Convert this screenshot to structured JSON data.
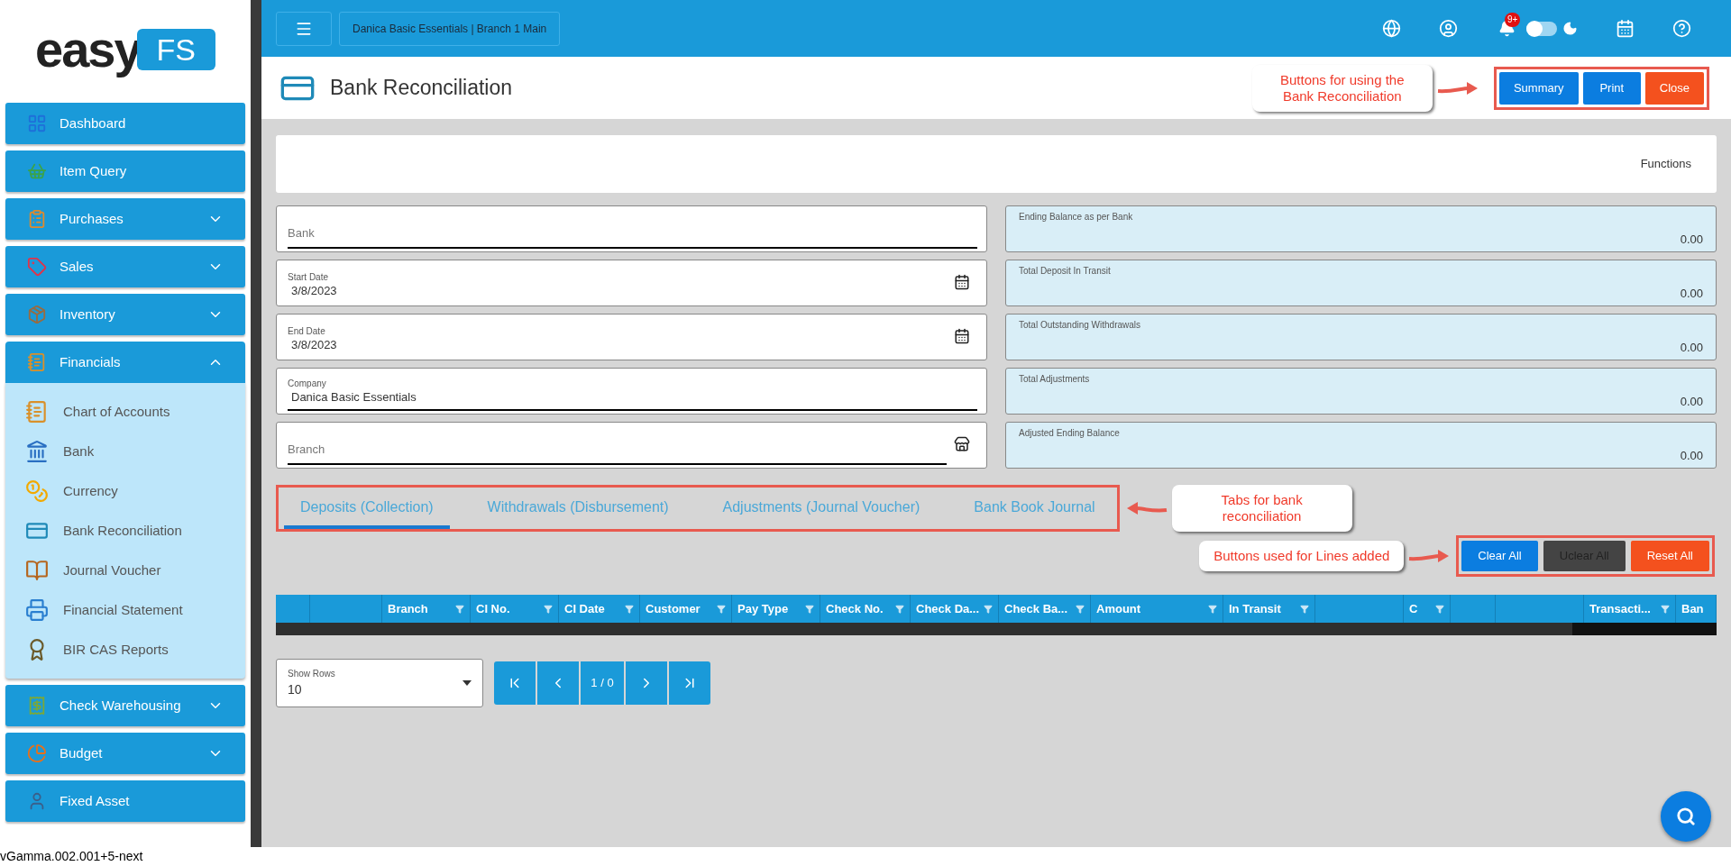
{
  "sidebar": {
    "logo": {
      "word": "easy",
      "badge": "FS"
    },
    "items": [
      {
        "label": "Dashboard"
      },
      {
        "label": "Item Query"
      },
      {
        "label": "Purchases",
        "expanded": false
      },
      {
        "label": "Sales",
        "expanded": false
      },
      {
        "label": "Inventory",
        "expanded": false
      },
      {
        "label": "Financials",
        "expanded": true,
        "children": [
          {
            "label": "Chart of Accounts"
          },
          {
            "label": "Bank"
          },
          {
            "label": "Currency"
          },
          {
            "label": "Bank Reconciliation"
          },
          {
            "label": "Journal Voucher"
          },
          {
            "label": "Financial Statement"
          },
          {
            "label": "BIR CAS Reports"
          }
        ]
      },
      {
        "label": "Check Warehousing",
        "expanded": false
      },
      {
        "label": "Budget",
        "expanded": false
      },
      {
        "label": "Fixed Asset"
      }
    ]
  },
  "topbar": {
    "context": "Danica Basic Essentials | Branch 1 Main",
    "notifications": "9+",
    "dark_mode": false
  },
  "header": {
    "title": "Bank Reconciliation",
    "buttons": [
      {
        "label": "Summary",
        "kind": "primary"
      },
      {
        "label": "Print",
        "kind": "primary"
      },
      {
        "label": "Close",
        "kind": "danger"
      }
    ],
    "callout": "Buttons for using the Bank Reconciliation"
  },
  "functions": {
    "label": "Functions"
  },
  "fields": [
    {
      "kind": "text",
      "placeholder": "Bank"
    },
    {
      "kind": "date",
      "label": "Start Date",
      "value": "3/8/2023"
    },
    {
      "kind": "date",
      "label": "End Date",
      "value": "3/8/2023"
    },
    {
      "kind": "text",
      "label": "Company",
      "value": "Danica Basic Essentials"
    },
    {
      "kind": "lookup",
      "placeholder": "Branch"
    }
  ],
  "totals": [
    {
      "label": "Ending Balance as per Bank",
      "value": "0.00"
    },
    {
      "label": "Total Deposit In Transit",
      "value": "0.00"
    },
    {
      "label": "Total Outstanding Withdrawals",
      "value": "0.00"
    },
    {
      "label": "Total Adjustments",
      "value": "0.00"
    },
    {
      "label": "Adjusted Ending Balance",
      "value": "0.00"
    }
  ],
  "tabs": [
    {
      "label": "Deposits (Collection)",
      "selected": true
    },
    {
      "label": "Withdrawals (Disbursement)",
      "selected": false
    },
    {
      "label": "Adjustments (Journal Voucher)",
      "selected": false
    },
    {
      "label": "Bank Book Journal",
      "selected": false
    }
  ],
  "tabs_callout": "Tabs for bank reconciliation",
  "line_buttons": [
    {
      "label": "Clear All",
      "kind": "primary"
    },
    {
      "label": "Uclear All",
      "kind": "dark"
    },
    {
      "label": "Reset All",
      "kind": "danger"
    }
  ],
  "line_buttons_callout": "Buttons used for Lines added",
  "table": {
    "columns": [
      {
        "filter": false
      },
      {
        "filter": false
      },
      {
        "label": "Branch",
        "filter": true
      },
      {
        "label": "CI No.",
        "filter": true
      },
      {
        "label": "CI Date",
        "filter": true
      },
      {
        "label": "Customer",
        "filter": true
      },
      {
        "label": "Pay Type",
        "filter": true
      },
      {
        "label": "Check No.",
        "filter": true
      },
      {
        "label": "Check Da...",
        "filter": true
      },
      {
        "label": "Check Ba...",
        "filter": true
      },
      {
        "label": "Amount",
        "filter": true
      },
      {
        "label": "In Transit",
        "filter": true
      },
      {
        "filter": false
      },
      {
        "label": "C",
        "filter": true
      },
      {
        "filter": false
      },
      {
        "filter": false
      },
      {
        "label": "Transacti...",
        "filter": true
      },
      {
        "label": "Ban",
        "filter": false
      }
    ]
  },
  "pager": {
    "rows_label": "Show Rows",
    "rows_value": "10",
    "page": "1 / 0"
  },
  "status_bar": {
    "version": "vGamma.002.001+5-next"
  }
}
